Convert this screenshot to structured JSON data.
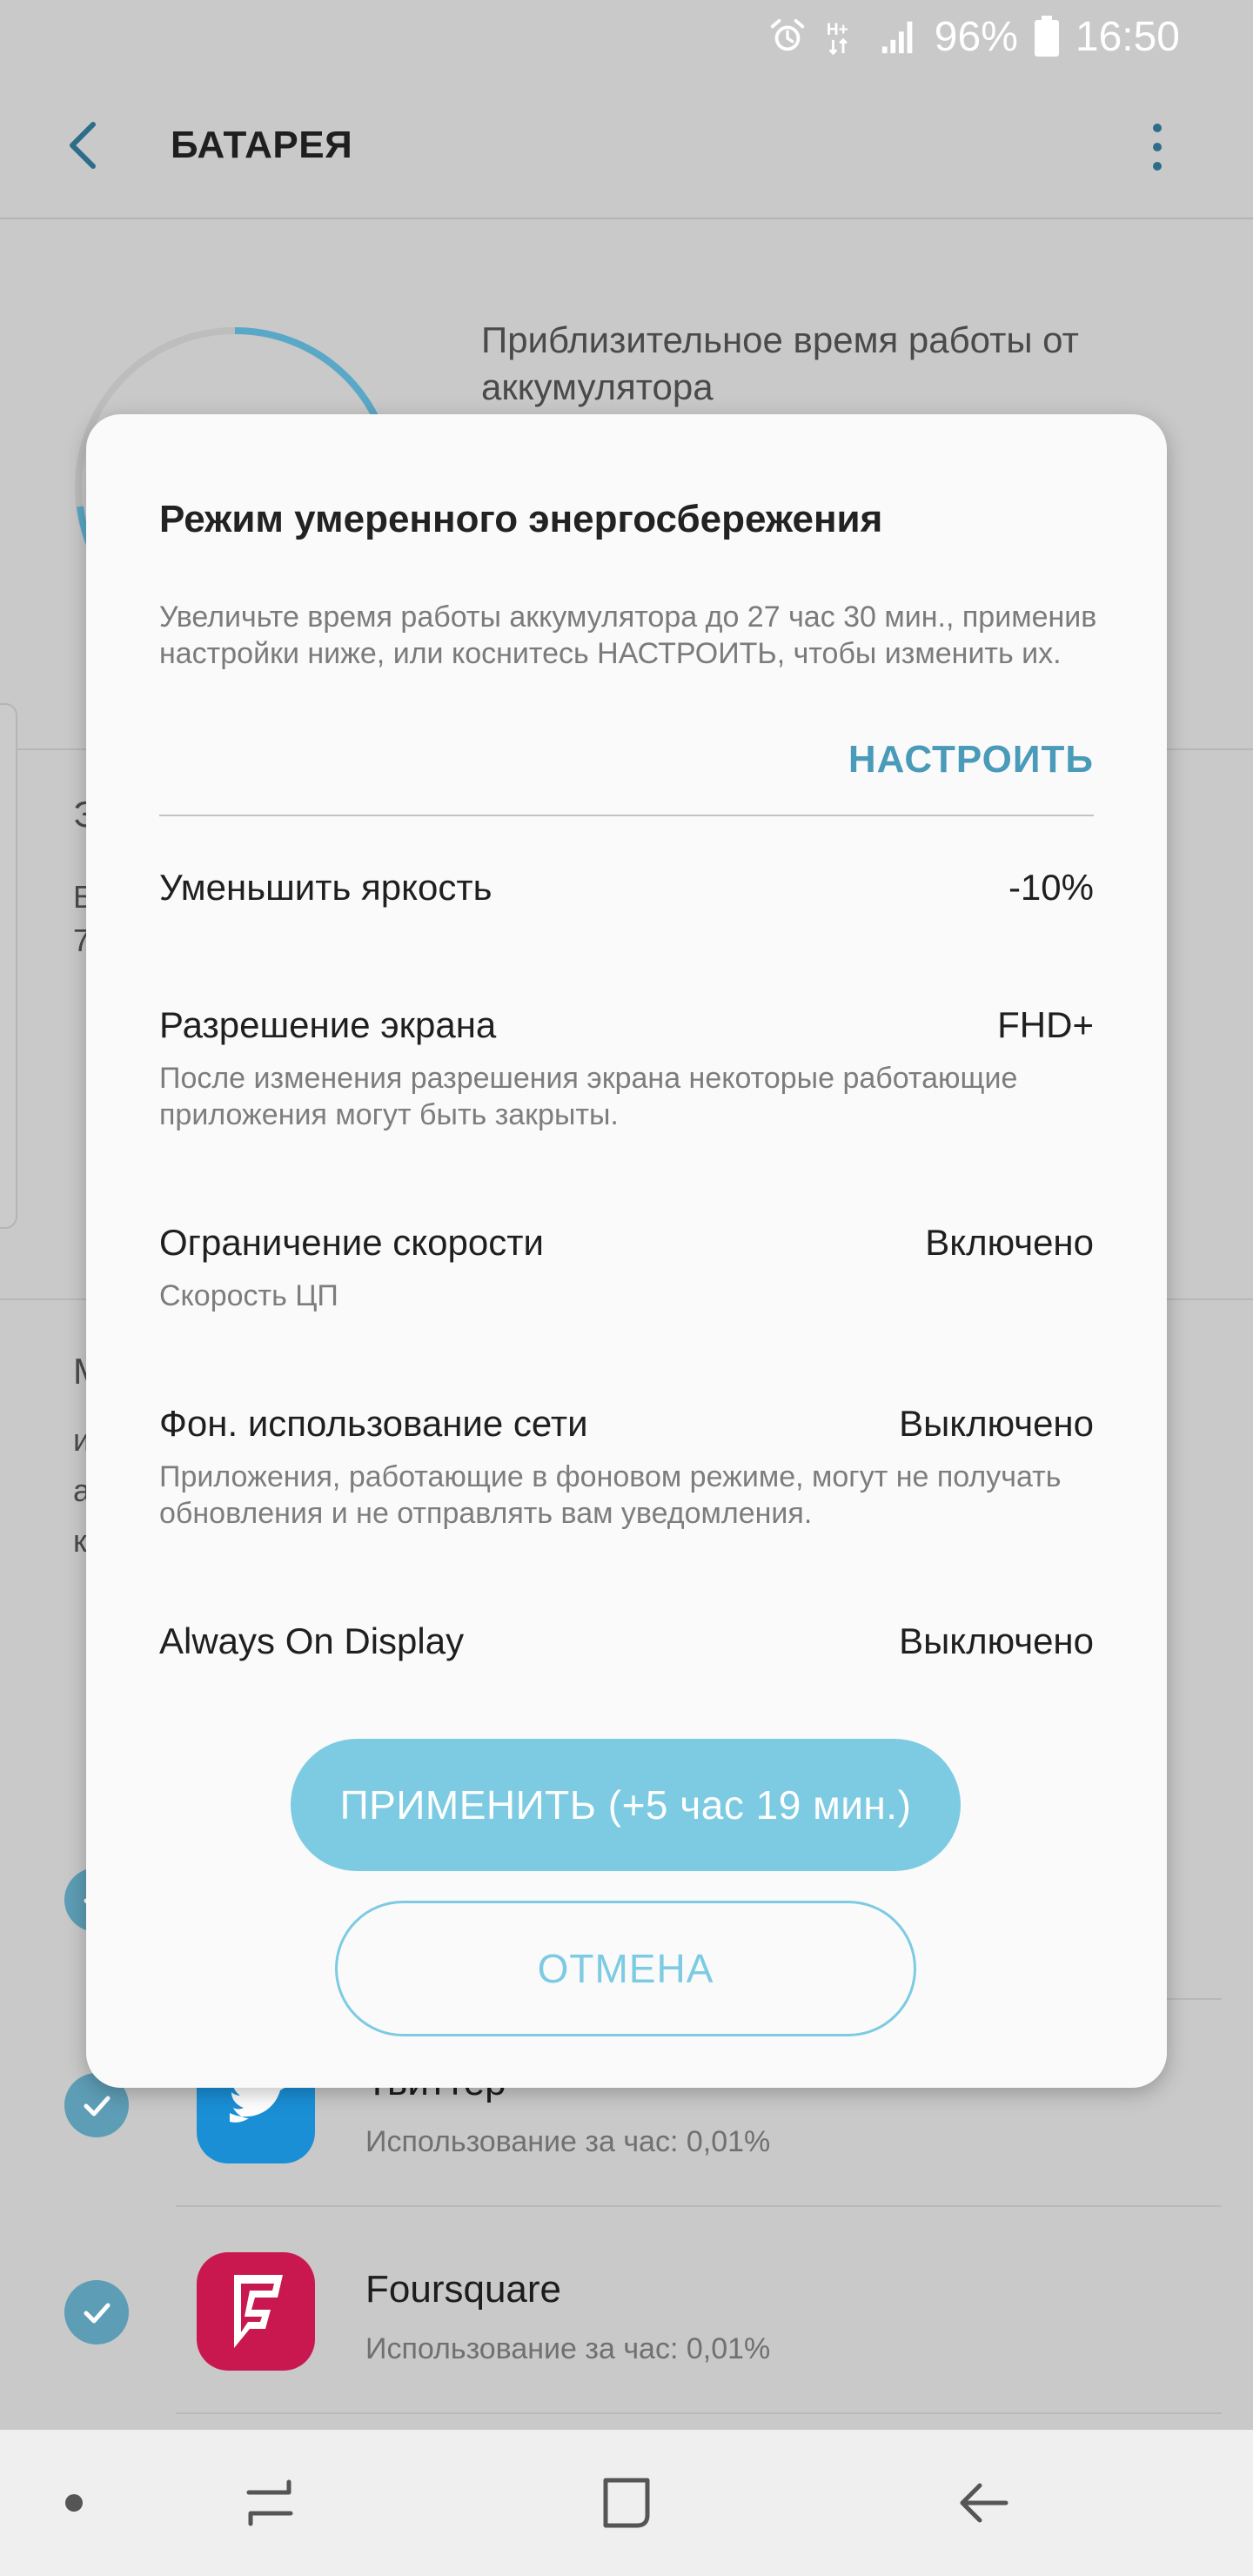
{
  "status_bar": {
    "battery_percent": "96%",
    "time": "16:50",
    "network_label": "H+",
    "icons": [
      "alarm-icon",
      "network-hplus-icon",
      "signal-icon",
      "battery-icon"
    ]
  },
  "app_bar": {
    "title": "БАТАРЕЯ",
    "back_icon": "chevron-left-icon",
    "more_icon": "more-vertical-icon"
  },
  "background": {
    "estimate_label": "Приблизительное время работы от аккумулятора",
    "apps": [
      {
        "name": "Твиттер",
        "usage": "Использование за час: 0,01%",
        "color": "#1a9be8"
      },
      {
        "name": "Foursquare",
        "usage": "Использование за час: 0,01%",
        "color": "#e8185a"
      }
    ]
  },
  "dialog": {
    "title": "Режим умеренного энергосбережения",
    "description": "Увеличьте время работы аккумулятора до 27 час 30 мин., применив настройки ниже, или коснитесь НАСТРОИТЬ, чтобы изменить их.",
    "customize_label": "НАСТРОИТЬ",
    "settings": [
      {
        "label": "Уменьшить яркость",
        "value": "-10%",
        "sub": ""
      },
      {
        "label": "Разрешение экрана",
        "value": "FHD+",
        "sub": "После изменения разрешения экрана некоторые работающие приложения могут быть закрыты."
      },
      {
        "label": "Ограничение скорости",
        "value": "Включено",
        "sub": "Скорость ЦП"
      },
      {
        "label": "Фон. использование сети",
        "value": "Выключено",
        "sub": "Приложения, работающие в фоновом режиме, могут не получать обновления и не отправлять вам уведомления."
      },
      {
        "label": "Always On Display",
        "value": "Выключено",
        "sub": ""
      }
    ],
    "apply_label": "ПРИМЕНИТЬ (+5 час 19 мин.)",
    "cancel_label": "ОТМЕНА"
  },
  "nav_bar": {
    "items": [
      "dot-icon",
      "recents-icon",
      "home-icon",
      "back-icon"
    ]
  },
  "colors": {
    "accent": "#4a9ab9",
    "button": "#7ccbe2",
    "scrim_background": "#c9c9c9",
    "check": "#5d9db5"
  }
}
